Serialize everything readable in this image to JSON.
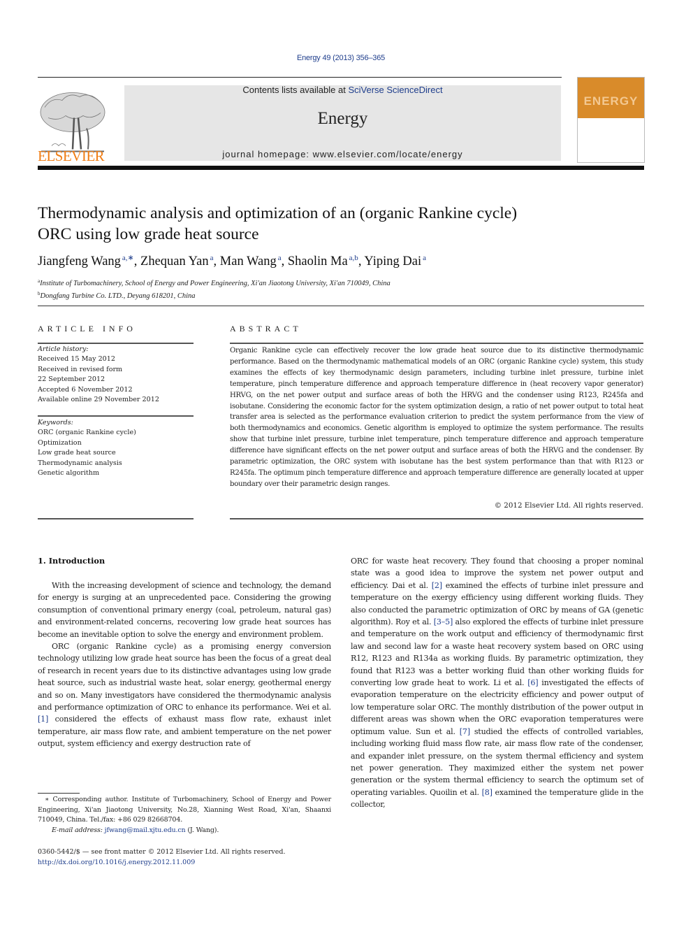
{
  "header": {
    "citation": "Energy 49 (2013) 356–365",
    "contents_prefix": "Contents lists available at ",
    "contents_link": "SciVerse ScienceDirect",
    "journal_name": "Energy",
    "homepage": "journal homepage: www.elsevier.com/locate/energy",
    "publisher_logo": "ELSEVIER",
    "cover_title": "ENERGY",
    "colors": {
      "publisher_orange": "#f07d14",
      "cover_orange": "#d98b2a",
      "link_blue": "#1f3e8c",
      "banner_gray": "#e6e6e6"
    }
  },
  "article": {
    "title_line1": "Thermodynamic analysis and optimization of an (organic Rankine cycle)",
    "title_line2": "ORC using low grade heat source",
    "authors": [
      {
        "name": "Jiangfeng Wang",
        "sup": "a,∗",
        "sep": ", "
      },
      {
        "name": "Zhequan Yan",
        "sup": "a",
        "sep": ", "
      },
      {
        "name": "Man Wang",
        "sup": "a",
        "sep": ", "
      },
      {
        "name": "Shaolin Ma",
        "sup": "a,b",
        "sep": ", "
      },
      {
        "name": "Yiping Dai",
        "sup": "a",
        "sep": ""
      }
    ],
    "affiliations": [
      {
        "mark": "a",
        "text": "Institute of Turbomachinery, School of Energy and Power Engineering, Xi'an Jiaotong University, Xi'an 710049, China"
      },
      {
        "mark": "b",
        "text": "Dongfang Turbine Co. LTD., Deyang 618201, China"
      }
    ]
  },
  "article_info": {
    "heading": "ARTICLE INFO",
    "history_label": "Article history:",
    "history": [
      "Received 15 May 2012",
      "Received in revised form",
      "22 September 2012",
      "Accepted 6 November 2012",
      "Available online 29 November 2012"
    ],
    "keywords_label": "Keywords:",
    "keywords": [
      "ORC (organic Rankine cycle)",
      "Optimization",
      "Low grade heat source",
      "Thermodynamic analysis",
      "Genetic algorithm"
    ]
  },
  "abstract": {
    "heading": "ABSTRACT",
    "text": "Organic Rankine cycle can effectively recover the low grade heat source due to its distinctive thermodynamic performance. Based on the thermodynamic mathematical models of an ORC (organic Rankine cycle) system, this study examines the effects of key thermodynamic design parameters, including turbine inlet pressure, turbine inlet temperature, pinch temperature difference and approach temperature difference in (heat recovery vapor generator) HRVG, on the net power output and surface areas of both the HRVG and the condenser using R123, R245fa and isobutane. Considering the economic factor for the system optimization design, a ratio of net power output to total heat transfer area is selected as the performance evaluation criterion to predict the system performance from the view of both thermodynamics and economics. Genetic algorithm is employed to optimize the system performance. The results show that turbine inlet pressure, turbine inlet temperature, pinch temperature difference and approach temperature difference have significant effects on the net power output and surface areas of both the HRVG and the condenser. By parametric optimization, the ORC system with isobutane has the best system performance than that with R123 or R245fa. The optimum pinch temperature difference and approach temperature difference are generally located at upper boundary over their parametric design ranges.",
    "copyright": "© 2012 Elsevier Ltd. All rights reserved."
  },
  "introduction": {
    "heading": "1.  Introduction",
    "p1": "With the increasing development of science and technology, the demand for energy is surging at an unprecedented pace. Considering the growing consumption of conventional primary energy (coal, petroleum, natural gas) and environment-related concerns, recovering low grade heat sources has become an inevitable option to solve the energy and environment problem.",
    "p2_a": "ORC (organic Rankine cycle) as a promising energy conversion technology utilizing low grade heat source has been the focus of a great deal of research in recent years due to its distinctive advantages using low grade heat source, such as industrial waste heat, solar energy, geothermal energy and so on. Many investigators have considered the thermodynamic analysis and performance optimization of ORC to enhance its performance. Wei et al. ",
    "ref1": "[1]",
    "p2_b": " considered the effects of exhaust mass flow rate, exhaust inlet temperature, air mass flow rate, and ambient temperature on the net power output, system efficiency and exergy destruction rate of",
    "r_a": "ORC for waste heat recovery. They found that choosing a proper nominal state was a good idea to improve the system net power output and efficiency. Dai et al. ",
    "ref2": "[2]",
    "r_b": " examined the effects of turbine inlet pressure and temperature on the exergy efficiency using different working fluids. They also conducted the parametric optimization of ORC by means of GA (genetic algorithm). Roy et al. ",
    "ref3": "[3–5]",
    "r_c": " also explored the effects of turbine inlet pressure and temperature on the work output and efficiency of thermodynamic first law and second law for a waste heat recovery system based on ORC using R12, R123 and R134a as working fluids. By parametric optimization, they found that R123 was a better working fluid than other working fluids for converting low grade heat to work. Li et al. ",
    "ref6": "[6]",
    "r_d": " investigated the effects of evaporation temperature on the electricity efficiency and power output of low temperature solar ORC. The monthly distribution of the power output in different areas was shown when the ORC evaporation temperatures were optimum value. Sun et al. ",
    "ref7": "[7]",
    "r_e": " studied the effects of controlled variables, including working fluid mass flow rate, air mass flow rate of the condenser, and expander inlet pressure, on the system thermal efficiency and system net power generation. They maximized either the system net power generation or the system thermal efficiency to search the optimum set of operating variables. Quoilin et al. ",
    "ref8": "[8]",
    "r_f": " examined the temperature glide in the collector,"
  },
  "footnote": {
    "text": "∗ Corresponding author. Institute of Turbomachinery, School of Energy and Power Engineering, Xi'an Jiaotong University, No.28, Xianning West Road, Xi'an, Shaanxi 710049, China. Tel./fax: +86 029 82668704.",
    "email_label": "E-mail address: ",
    "email": "jfwang@mail.xjtu.edu.cn",
    "email_suffix": " (J. Wang).",
    "front_matter": "0360-5442/$ — see front matter © 2012 Elsevier Ltd. All rights reserved.",
    "doi": "http://dx.doi.org/10.1016/j.energy.2012.11.009"
  }
}
